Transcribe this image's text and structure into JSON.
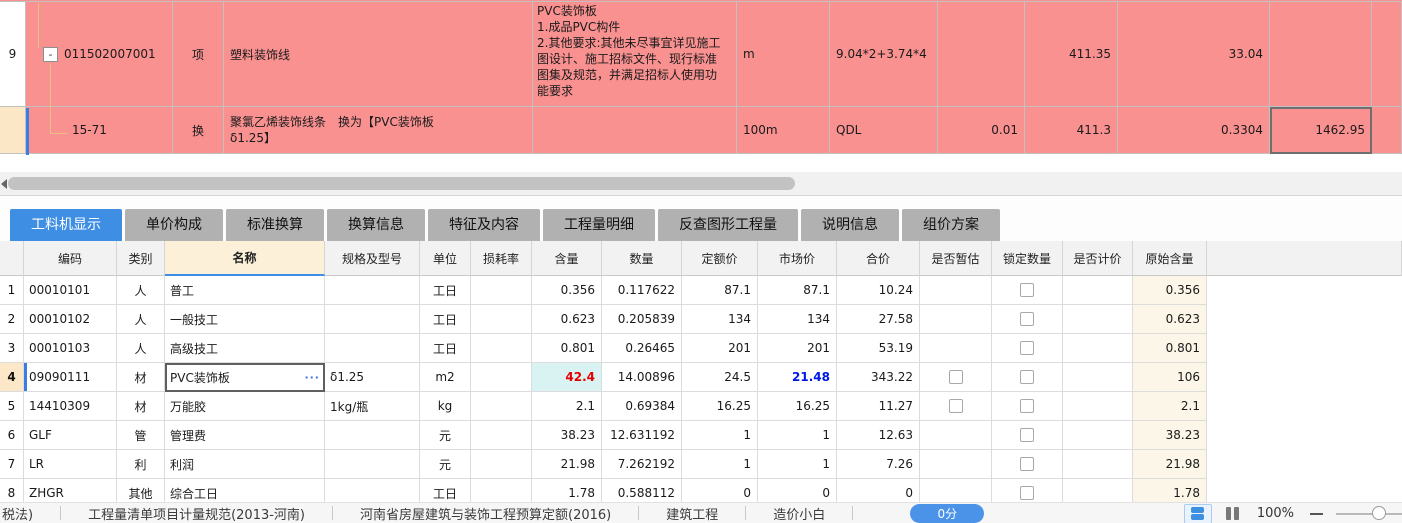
{
  "colors": {
    "row_pink": "#fa9191",
    "accent_blue": "#3e8ee4",
    "selected_cream": "#fce8c8",
    "content_highlight_bg": "#d9f3f3",
    "content_highlight_red": "#e60000",
    "market_highlight_blue": "#0018e6",
    "tree_line_orange": "#e7c27c"
  },
  "top_grid": {
    "rows": [
      {
        "row_no": "9",
        "expand_icon": "-",
        "code": "011502007001",
        "type": "项",
        "name": "塑料装饰线",
        "description": "PVC装饰板\n1.成品PVC构件\n2.其他要求:其他未尽事宜详见施工图设计、施工招标文件、现行标准图集及规范，并满足招标人使用功能要求",
        "unit": "m",
        "expression": "9.04*2+3.74*4",
        "quantity": "",
        "price": "411.35",
        "total": "33.04",
        "extra": ""
      },
      {
        "row_no": "",
        "code": "15-71",
        "type": "换",
        "name": "聚氯乙烯装饰线条　换为【PVC装饰板\nδ1.25】",
        "description": "",
        "unit": "100m",
        "expression": "QDL",
        "quantity": "0.01",
        "price": "411.3",
        "total": "0.3304",
        "extra": "1462.95"
      }
    ]
  },
  "tabs": {
    "active": "工料机显示",
    "items": [
      "工料机显示",
      "单价构成",
      "标准换算",
      "换算信息",
      "特征及内容",
      "工程量明细",
      "反查图形工程量",
      "说明信息",
      "组价方案"
    ]
  },
  "grid": {
    "headers": [
      "编码",
      "类别",
      "名称",
      "规格及型号",
      "单位",
      "损耗率",
      "含量",
      "数量",
      "定额价",
      "市场价",
      "合价",
      "是否暂估",
      "锁定数量",
      "是否计价",
      "原始含量"
    ],
    "rows": [
      {
        "no": "1",
        "code": "00010101",
        "category": "人",
        "name": "普工",
        "spec": "",
        "unit": "工日",
        "loss": "",
        "content": "0.356",
        "quantity": "0.117622",
        "base_price": "87.1",
        "market_price": "87.1",
        "total": "10.24",
        "estimate_box": false,
        "lock_box": true,
        "priced_box": false,
        "original": "0.356",
        "selected": false
      },
      {
        "no": "2",
        "code": "00010102",
        "category": "人",
        "name": "一般技工",
        "spec": "",
        "unit": "工日",
        "loss": "",
        "content": "0.623",
        "quantity": "0.205839",
        "base_price": "134",
        "market_price": "134",
        "total": "27.58",
        "estimate_box": false,
        "lock_box": true,
        "priced_box": false,
        "original": "0.623",
        "selected": false
      },
      {
        "no": "3",
        "code": "00010103",
        "category": "人",
        "name": "高级技工",
        "spec": "",
        "unit": "工日",
        "loss": "",
        "content": "0.801",
        "quantity": "0.26465",
        "base_price": "201",
        "market_price": "201",
        "total": "53.19",
        "estimate_box": false,
        "lock_box": true,
        "priced_box": false,
        "original": "0.801",
        "selected": false
      },
      {
        "no": "4",
        "code": "09090111",
        "category": "材",
        "name": "PVC装饰板",
        "more_button": "···",
        "spec": "δ1.25",
        "unit": "m2",
        "loss": "",
        "content": "42.4",
        "quantity": "14.00896",
        "base_price": "24.5",
        "market_price": "21.48",
        "total": "343.22",
        "estimate_box": true,
        "lock_box": true,
        "priced_box": false,
        "original": "106",
        "selected": true
      },
      {
        "no": "5",
        "code": "14410309",
        "category": "材",
        "name": "万能胶",
        "spec": "1kg/瓶",
        "unit": "kg",
        "loss": "",
        "content": "2.1",
        "quantity": "0.69384",
        "base_price": "16.25",
        "market_price": "16.25",
        "total": "11.27",
        "estimate_box": true,
        "lock_box": true,
        "priced_box": false,
        "original": "2.1",
        "selected": false
      },
      {
        "no": "6",
        "code": "GLF",
        "category": "管",
        "name": "管理费",
        "spec": "",
        "unit": "元",
        "loss": "",
        "content": "38.23",
        "quantity": "12.631192",
        "base_price": "1",
        "market_price": "1",
        "total": "12.63",
        "estimate_box": false,
        "lock_box": true,
        "priced_box": false,
        "original": "38.23",
        "selected": false
      },
      {
        "no": "7",
        "code": "LR",
        "category": "利",
        "name": "利润",
        "spec": "",
        "unit": "元",
        "loss": "",
        "content": "21.98",
        "quantity": "7.262192",
        "base_price": "1",
        "market_price": "1",
        "total": "7.26",
        "estimate_box": false,
        "lock_box": true,
        "priced_box": false,
        "original": "21.98",
        "selected": false
      },
      {
        "no": "8",
        "code": "ZHGR",
        "category": "其他",
        "name": "综合工日",
        "spec": "",
        "unit": "工日",
        "loss": "",
        "content": "1.78",
        "quantity": "0.588112",
        "base_price": "0",
        "market_price": "0",
        "total": "0",
        "estimate_box": false,
        "lock_box": true,
        "priced_box": false,
        "original": "1.78",
        "selected": false
      }
    ]
  },
  "status_bar": {
    "items": [
      "税法)",
      "工程量清单项目计量规范(2013-河南)",
      "河南省房屋建筑与装饰工程预算定额(2016)",
      "建筑工程",
      "造价小白"
    ],
    "score_button": "0分",
    "zoom_percent": "100%"
  }
}
